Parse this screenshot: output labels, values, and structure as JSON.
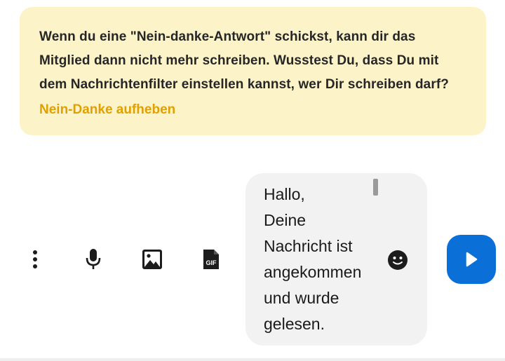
{
  "notice": {
    "text": "Wenn du eine \"Nein-danke-Antwort\" schickst, kann dir das Mitglied dann nicht mehr schreiben. Wusstest Du, dass Du mit dem Nachrichtenfilter einstellen kannst, wer Dir schreiben darf?",
    "undo_link": "Nein-Danke aufheben"
  },
  "toolbar": {
    "items": [
      {
        "icon": "more-vertical-icon"
      },
      {
        "icon": "microphone-icon"
      },
      {
        "icon": "image-icon"
      },
      {
        "icon": "gif-icon",
        "label": "GIF"
      }
    ]
  },
  "composer": {
    "message": "Hallo,\nDeine\nNachricht ist\nangekommen\nund wurde\ngelesen.",
    "emoji_icon": "smiley-icon"
  },
  "send": {
    "icon": "send-play-icon"
  },
  "colors": {
    "notice_background": "#fcf3c9",
    "link": "#e0a100",
    "send_button": "#0a6fd6",
    "composer_background": "#f2f2f2"
  }
}
